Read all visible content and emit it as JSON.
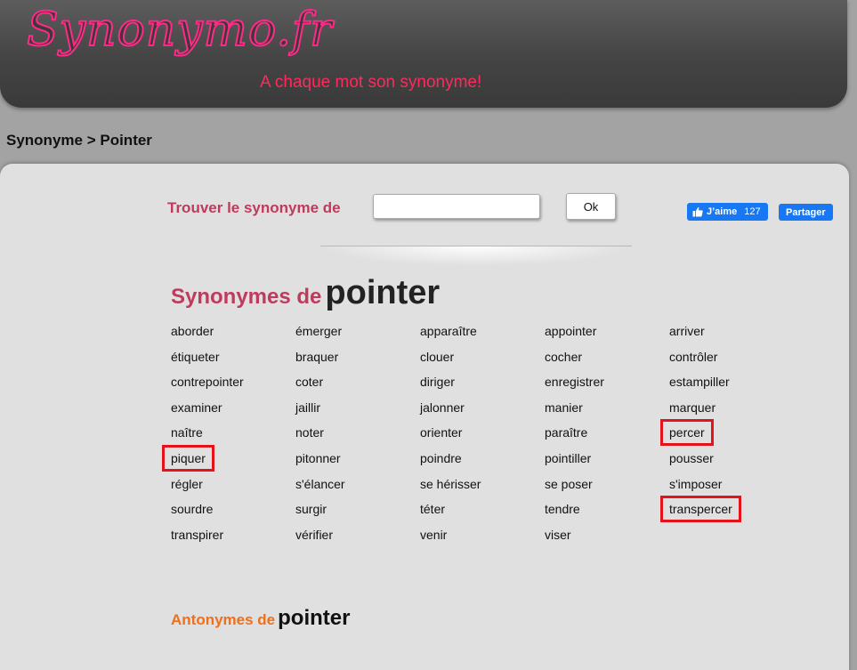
{
  "header": {
    "logo": "Synonymo.fr",
    "tagline": "A chaque mot son synonyme!"
  },
  "breadcrumb": {
    "home": "Synonyme",
    "separator": " > ",
    "current": "Pointer"
  },
  "search": {
    "label": "Trouver le synonyme de",
    "value": "",
    "placeholder": "",
    "button_label": "Ok"
  },
  "social": {
    "like_label": "J’aime",
    "like_count": "127",
    "share_label": "Partager"
  },
  "synonyms_section": {
    "prefix": "Synonymes de",
    "word": "pointer"
  },
  "synonyms": [
    "aborder",
    "émerger",
    "apparaître",
    "appointer",
    "arriver",
    "étiqueter",
    "braquer",
    "clouer",
    "cocher",
    "contrôler",
    "contrepointer",
    "coter",
    "diriger",
    "enregistrer",
    "estampiller",
    "examiner",
    "jaillir",
    "jalonner",
    "manier",
    "marquer",
    "naître",
    "noter",
    "orienter",
    "paraître",
    "percer",
    "piquer",
    "pitonner",
    "poindre",
    "pointiller",
    "pousser",
    "régler",
    "s'élancer",
    "se hérisser",
    "se poser",
    "s'imposer",
    "sourdre",
    "surgir",
    "téter",
    "tendre",
    "transpercer",
    "transpirer",
    "vérifier",
    "venir",
    "viser"
  ],
  "highlighted": [
    "piquer",
    "percer",
    "transpercer"
  ],
  "antonyms_section": {
    "prefix": "Antonymes de",
    "word": "pointer"
  },
  "colors": {
    "header_bg": "#444444",
    "logo": "#ff2a86",
    "tagline": "#ff2a5c",
    "search_label": "#bf3a5c",
    "antonyms_label": "#ef6f1a",
    "highlight_box": "#e3121b",
    "facebook": "#1877f2"
  }
}
